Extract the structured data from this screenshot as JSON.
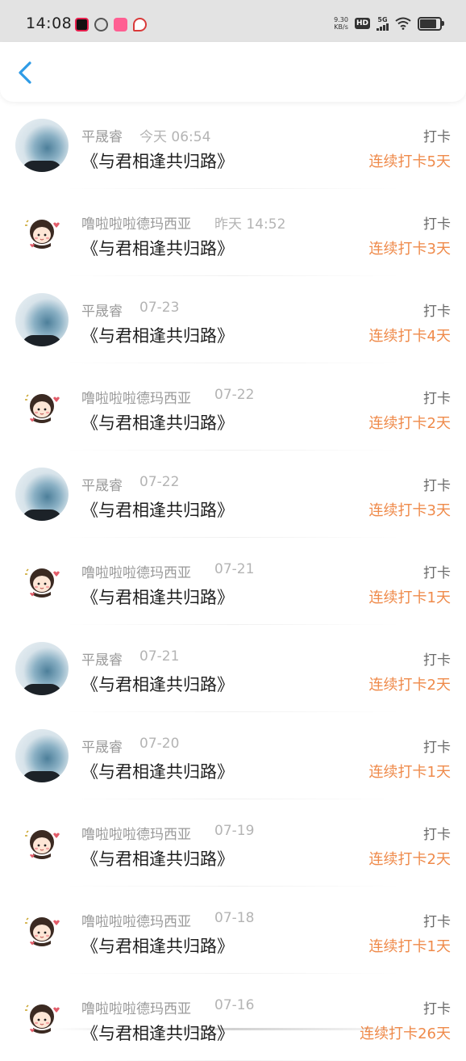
{
  "status_bar": {
    "time": "14:08",
    "net_speed": "9.30",
    "net_unit": "KB/s",
    "hd": "HD",
    "network": "5G",
    "app_icon_colors": [
      "#e8204e",
      "#555555",
      "#ff5f92",
      "#d93a3a"
    ]
  },
  "header": {
    "back_icon": "chevron-left-icon",
    "accent": "#2e9be6"
  },
  "colors": {
    "name": "#9a9a9a",
    "date": "#b4b4b4",
    "title": "#1f1f1f",
    "streak": "#ef8a4a"
  },
  "records": [
    {
      "avatar": "photo-avatar",
      "name": "平晟睿",
      "date": "今天 06:54",
      "title": "《与君相逢共归路》",
      "type": "打卡",
      "streak": "连续打卡5天"
    },
    {
      "avatar": "cartoon-girl-avatar",
      "name": "噜啦啦啦德玛西亚",
      "date": "昨天 14:52",
      "title": "《与君相逢共归路》",
      "type": "打卡",
      "streak": "连续打卡3天"
    },
    {
      "avatar": "photo-avatar",
      "name": "平晟睿",
      "date": "07-23",
      "title": "《与君相逢共归路》",
      "type": "打卡",
      "streak": "连续打卡4天"
    },
    {
      "avatar": "cartoon-girl-avatar",
      "name": "噜啦啦啦德玛西亚",
      "date": "07-22",
      "title": "《与君相逢共归路》",
      "type": "打卡",
      "streak": "连续打卡2天"
    },
    {
      "avatar": "photo-avatar",
      "name": "平晟睿",
      "date": "07-22",
      "title": "《与君相逢共归路》",
      "type": "打卡",
      "streak": "连续打卡3天"
    },
    {
      "avatar": "cartoon-girl-avatar",
      "name": "噜啦啦啦德玛西亚",
      "date": "07-21",
      "title": "《与君相逢共归路》",
      "type": "打卡",
      "streak": "连续打卡1天"
    },
    {
      "avatar": "photo-avatar",
      "name": "平晟睿",
      "date": "07-21",
      "title": "《与君相逢共归路》",
      "type": "打卡",
      "streak": "连续打卡2天"
    },
    {
      "avatar": "photo-avatar",
      "name": "平晟睿",
      "date": "07-20",
      "title": "《与君相逢共归路》",
      "type": "打卡",
      "streak": "连续打卡1天"
    },
    {
      "avatar": "cartoon-girl-avatar",
      "name": "噜啦啦啦德玛西亚",
      "date": "07-19",
      "title": "《与君相逢共归路》",
      "type": "打卡",
      "streak": "连续打卡2天"
    },
    {
      "avatar": "cartoon-girl-avatar",
      "name": "噜啦啦啦德玛西亚",
      "date": "07-18",
      "title": "《与君相逢共归路》",
      "type": "打卡",
      "streak": "连续打卡1天"
    },
    {
      "avatar": "cartoon-girl-avatar",
      "name": "噜啦啦啦德玛西亚",
      "date": "07-16",
      "title": "《与君相逢共归路》",
      "type": "打卡",
      "streak": "连续打卡26天"
    }
  ]
}
